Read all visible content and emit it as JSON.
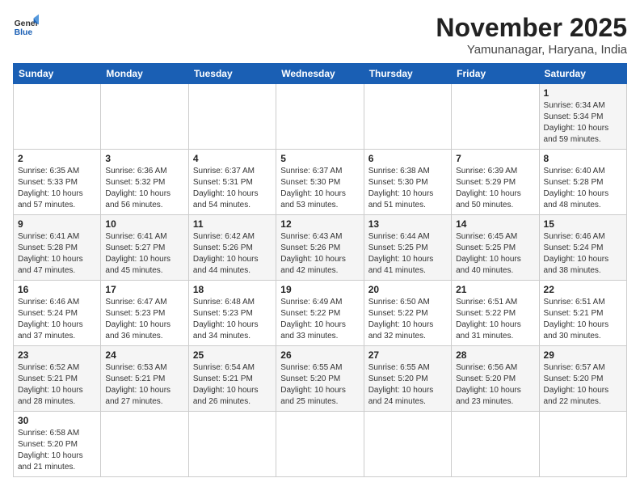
{
  "header": {
    "logo_general": "General",
    "logo_blue": "Blue",
    "month_title": "November 2025",
    "location": "Yamunanagar, Haryana, India"
  },
  "days_of_week": [
    "Sunday",
    "Monday",
    "Tuesday",
    "Wednesday",
    "Thursday",
    "Friday",
    "Saturday"
  ],
  "weeks": [
    [
      {
        "day": "",
        "info": ""
      },
      {
        "day": "",
        "info": ""
      },
      {
        "day": "",
        "info": ""
      },
      {
        "day": "",
        "info": ""
      },
      {
        "day": "",
        "info": ""
      },
      {
        "day": "",
        "info": ""
      },
      {
        "day": "1",
        "info": "Sunrise: 6:34 AM\nSunset: 5:34 PM\nDaylight: 10 hours\nand 59 minutes."
      }
    ],
    [
      {
        "day": "2",
        "info": "Sunrise: 6:35 AM\nSunset: 5:33 PM\nDaylight: 10 hours\nand 57 minutes."
      },
      {
        "day": "3",
        "info": "Sunrise: 6:36 AM\nSunset: 5:32 PM\nDaylight: 10 hours\nand 56 minutes."
      },
      {
        "day": "4",
        "info": "Sunrise: 6:37 AM\nSunset: 5:31 PM\nDaylight: 10 hours\nand 54 minutes."
      },
      {
        "day": "5",
        "info": "Sunrise: 6:37 AM\nSunset: 5:30 PM\nDaylight: 10 hours\nand 53 minutes."
      },
      {
        "day": "6",
        "info": "Sunrise: 6:38 AM\nSunset: 5:30 PM\nDaylight: 10 hours\nand 51 minutes."
      },
      {
        "day": "7",
        "info": "Sunrise: 6:39 AM\nSunset: 5:29 PM\nDaylight: 10 hours\nand 50 minutes."
      },
      {
        "day": "8",
        "info": "Sunrise: 6:40 AM\nSunset: 5:28 PM\nDaylight: 10 hours\nand 48 minutes."
      }
    ],
    [
      {
        "day": "9",
        "info": "Sunrise: 6:41 AM\nSunset: 5:28 PM\nDaylight: 10 hours\nand 47 minutes."
      },
      {
        "day": "10",
        "info": "Sunrise: 6:41 AM\nSunset: 5:27 PM\nDaylight: 10 hours\nand 45 minutes."
      },
      {
        "day": "11",
        "info": "Sunrise: 6:42 AM\nSunset: 5:26 PM\nDaylight: 10 hours\nand 44 minutes."
      },
      {
        "day": "12",
        "info": "Sunrise: 6:43 AM\nSunset: 5:26 PM\nDaylight: 10 hours\nand 42 minutes."
      },
      {
        "day": "13",
        "info": "Sunrise: 6:44 AM\nSunset: 5:25 PM\nDaylight: 10 hours\nand 41 minutes."
      },
      {
        "day": "14",
        "info": "Sunrise: 6:45 AM\nSunset: 5:25 PM\nDaylight: 10 hours\nand 40 minutes."
      },
      {
        "day": "15",
        "info": "Sunrise: 6:46 AM\nSunset: 5:24 PM\nDaylight: 10 hours\nand 38 minutes."
      }
    ],
    [
      {
        "day": "16",
        "info": "Sunrise: 6:46 AM\nSunset: 5:24 PM\nDaylight: 10 hours\nand 37 minutes."
      },
      {
        "day": "17",
        "info": "Sunrise: 6:47 AM\nSunset: 5:23 PM\nDaylight: 10 hours\nand 36 minutes."
      },
      {
        "day": "18",
        "info": "Sunrise: 6:48 AM\nSunset: 5:23 PM\nDaylight: 10 hours\nand 34 minutes."
      },
      {
        "day": "19",
        "info": "Sunrise: 6:49 AM\nSunset: 5:22 PM\nDaylight: 10 hours\nand 33 minutes."
      },
      {
        "day": "20",
        "info": "Sunrise: 6:50 AM\nSunset: 5:22 PM\nDaylight: 10 hours\nand 32 minutes."
      },
      {
        "day": "21",
        "info": "Sunrise: 6:51 AM\nSunset: 5:22 PM\nDaylight: 10 hours\nand 31 minutes."
      },
      {
        "day": "22",
        "info": "Sunrise: 6:51 AM\nSunset: 5:21 PM\nDaylight: 10 hours\nand 30 minutes."
      }
    ],
    [
      {
        "day": "23",
        "info": "Sunrise: 6:52 AM\nSunset: 5:21 PM\nDaylight: 10 hours\nand 28 minutes."
      },
      {
        "day": "24",
        "info": "Sunrise: 6:53 AM\nSunset: 5:21 PM\nDaylight: 10 hours\nand 27 minutes."
      },
      {
        "day": "25",
        "info": "Sunrise: 6:54 AM\nSunset: 5:21 PM\nDaylight: 10 hours\nand 26 minutes."
      },
      {
        "day": "26",
        "info": "Sunrise: 6:55 AM\nSunset: 5:20 PM\nDaylight: 10 hours\nand 25 minutes."
      },
      {
        "day": "27",
        "info": "Sunrise: 6:55 AM\nSunset: 5:20 PM\nDaylight: 10 hours\nand 24 minutes."
      },
      {
        "day": "28",
        "info": "Sunrise: 6:56 AM\nSunset: 5:20 PM\nDaylight: 10 hours\nand 23 minutes."
      },
      {
        "day": "29",
        "info": "Sunrise: 6:57 AM\nSunset: 5:20 PM\nDaylight: 10 hours\nand 22 minutes."
      }
    ],
    [
      {
        "day": "30",
        "info": "Sunrise: 6:58 AM\nSunset: 5:20 PM\nDaylight: 10 hours\nand 21 minutes."
      },
      {
        "day": "",
        "info": ""
      },
      {
        "day": "",
        "info": ""
      },
      {
        "day": "",
        "info": ""
      },
      {
        "day": "",
        "info": ""
      },
      {
        "day": "",
        "info": ""
      },
      {
        "day": "",
        "info": ""
      }
    ]
  ]
}
